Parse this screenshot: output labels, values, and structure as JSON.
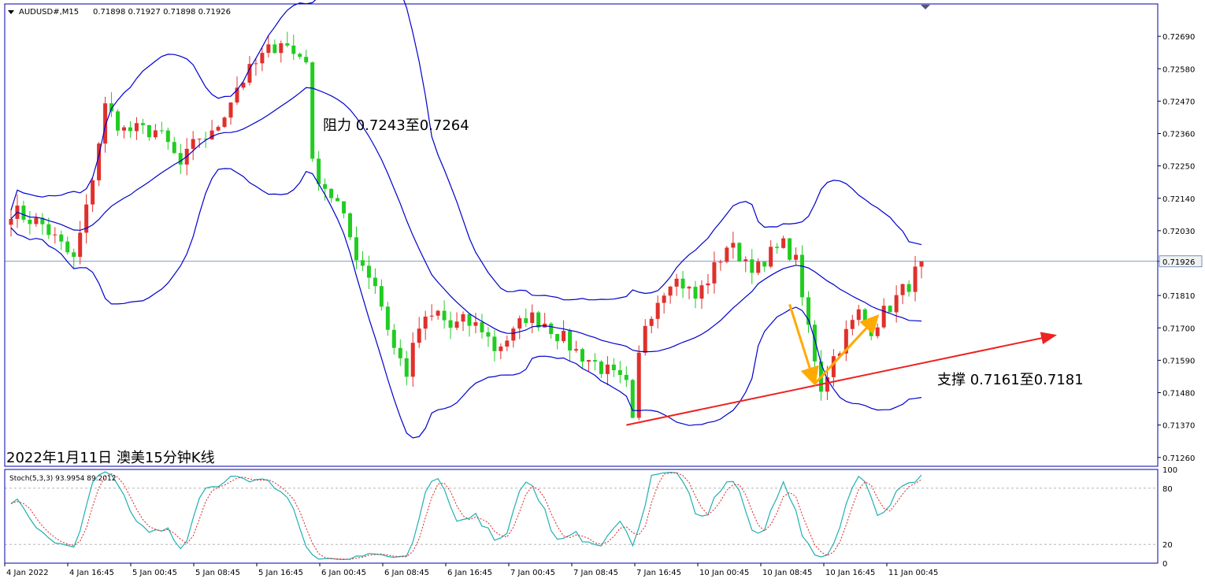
{
  "header": {
    "symbol": "AUDUSD#,M15",
    "ohlc": "0.71898 0.71927 0.71898 0.71926",
    "stoch_label": "Stoch(5,3,3) 93.9954 89.2012"
  },
  "colors": {
    "bull": "#e0302c",
    "bear": "#22cc22",
    "bands": "#0000cc",
    "stoch_main": "#20b0b0",
    "stoch_signal": "#dd2222",
    "support_line": "#ee2222",
    "v_arrows": "#ffaa00",
    "frame": "#0000aa"
  },
  "annotations": {
    "resistance": "阻力 0.7243至0.7264",
    "support": "支撑 0.7161至0.7181",
    "caption": "2022年1月11日 澳美15分钟K线"
  },
  "chart_data": {
    "type": "candlestick",
    "symbol": "AUDUSD",
    "timeframe": "M15",
    "current_price": "0.71926",
    "y_ticks": [
      "0.72690",
      "0.72580",
      "0.72470",
      "0.72360",
      "0.72250",
      "0.72140",
      "0.72030",
      "0.71926",
      "0.71810",
      "0.71700",
      "0.71590",
      "0.71480",
      "0.71370",
      "0.71260"
    ],
    "ylim": [
      0.7123,
      0.728
    ],
    "x_ticks": [
      "4 Jan 2022",
      "4 Jan 16:45",
      "5 Jan 00:45",
      "5 Jan 08:45",
      "5 Jan 16:45",
      "6 Jan 00:45",
      "6 Jan 08:45",
      "6 Jan 16:45",
      "7 Jan 00:45",
      "7 Jan 08:45",
      "7 Jan 16:45",
      "10 Jan 00:45",
      "10 Jan 08:45",
      "10 Jan 16:45",
      "11 Jan 00:45"
    ],
    "close_path": [
      [
        0,
        0.721
      ],
      [
        5,
        0.7205
      ],
      [
        10,
        0.7193
      ],
      [
        12,
        0.721
      ],
      [
        15,
        0.7245
      ],
      [
        18,
        0.7237
      ],
      [
        23,
        0.7237
      ],
      [
        25,
        0.7232
      ],
      [
        27,
        0.7225
      ],
      [
        30,
        0.7235
      ],
      [
        32,
        0.7235
      ],
      [
        36,
        0.7252
      ],
      [
        40,
        0.7262
      ],
      [
        43,
        0.7268
      ],
      [
        45,
        0.7263
      ],
      [
        47,
        0.7262
      ],
      [
        48,
        0.7225
      ],
      [
        50,
        0.7218
      ],
      [
        52,
        0.7212
      ],
      [
        55,
        0.7195
      ],
      [
        58,
        0.7185
      ],
      [
        61,
        0.7163
      ],
      [
        63,
        0.7155
      ],
      [
        65,
        0.717
      ],
      [
        68,
        0.7175
      ],
      [
        70,
        0.717
      ],
      [
        72,
        0.7172
      ],
      [
        75,
        0.717
      ],
      [
        77,
        0.7163
      ],
      [
        80,
        0.7168
      ],
      [
        82,
        0.7174
      ],
      [
        85,
        0.7172
      ],
      [
        87,
        0.7168
      ],
      [
        90,
        0.7162
      ],
      [
        93,
        0.7158
      ],
      [
        95,
        0.7155
      ],
      [
        98,
        0.715
      ],
      [
        99,
        0.7137
      ],
      [
        100,
        0.716
      ],
      [
        101,
        0.7172
      ],
      [
        103,
        0.718
      ],
      [
        105,
        0.7187
      ],
      [
        107,
        0.7185
      ],
      [
        109,
        0.718
      ],
      [
        112,
        0.719
      ],
      [
        114,
        0.7198
      ],
      [
        116,
        0.7195
      ],
      [
        119,
        0.719
      ],
      [
        120,
        0.719
      ],
      [
        122,
        0.72
      ],
      [
        123,
        0.7198
      ],
      [
        125,
        0.7192
      ],
      [
        126,
        0.718
      ],
      [
        128,
        0.716
      ],
      [
        129,
        0.715
      ],
      [
        131,
        0.716
      ],
      [
        133,
        0.7168
      ],
      [
        135,
        0.7175
      ],
      [
        137,
        0.717
      ],
      [
        139,
        0.7175
      ],
      [
        141,
        0.718
      ],
      [
        143,
        0.7185
      ],
      [
        145,
        0.7192
      ],
      [
        146,
        0.71926
      ]
    ],
    "indicators": {
      "bollinger_bands": true,
      "stochastic": {
        "params": [
          5,
          3,
          3
        ],
        "main": "93.9954",
        "signal": "89.2012",
        "levels": [
          "100",
          "80",
          "20",
          "0"
        ]
      }
    }
  }
}
